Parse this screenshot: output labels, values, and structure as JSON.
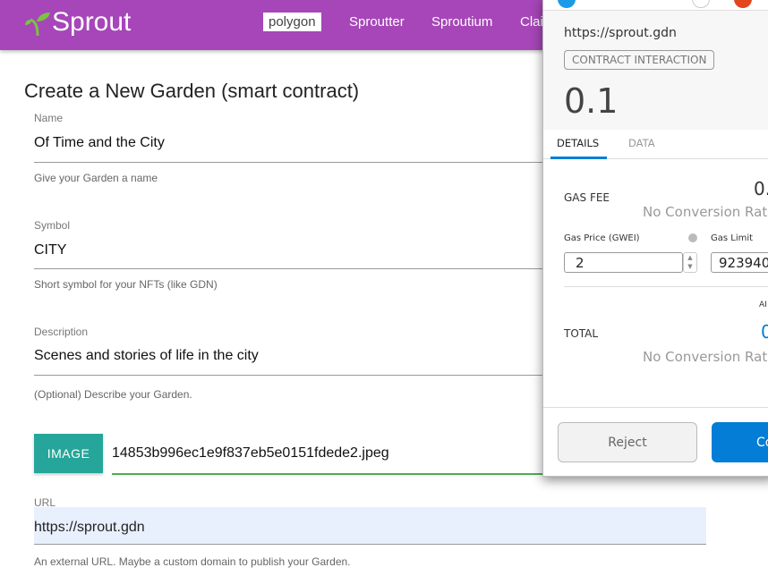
{
  "header": {
    "logo": "Sprout",
    "nav": [
      "polygon",
      "Sproutter",
      "Sproutium",
      "Clai"
    ]
  },
  "form": {
    "title": "Create a New Garden (smart contract)",
    "name": {
      "label": "Name",
      "value": "Of Time and the City",
      "help": "Give your Garden a name"
    },
    "symbol": {
      "label": "Symbol",
      "value": "CITY",
      "help": "Short symbol for your NFTs (like GDN)"
    },
    "description": {
      "label": "Description",
      "value": "Scenes and stories of life in the city",
      "help": "(Optional) Describe your Garden."
    },
    "image": {
      "button": "IMAGE",
      "value": "14853b996ec1e9f837eb5e0151fdede2.jpeg"
    },
    "url": {
      "label": "URL",
      "value": "https://sprout.gdn",
      "help": "An external URL. Maybe a custom domain to publish your Garden."
    }
  },
  "popup": {
    "origin": "https://sprout.gdn",
    "badge": "CONTRACT INTERACTION",
    "amount": "0.1",
    "tabs": [
      "DETAILS",
      "DATA"
    ],
    "gas_fee_label": "GAS FEE",
    "gas_fee_value": "0.",
    "no_conversion": "No Conversion Rat",
    "gas_price_label": "Gas Price (GWEI)",
    "gas_price": "2",
    "gas_limit_label": "Gas Limit",
    "gas_limit": "923940",
    "amount_label": "AI",
    "total_label": "TOTAL",
    "total_value": "0",
    "no_conversion2": "No Conversion Rat",
    "reject": "Reject",
    "confirm": "Co"
  }
}
